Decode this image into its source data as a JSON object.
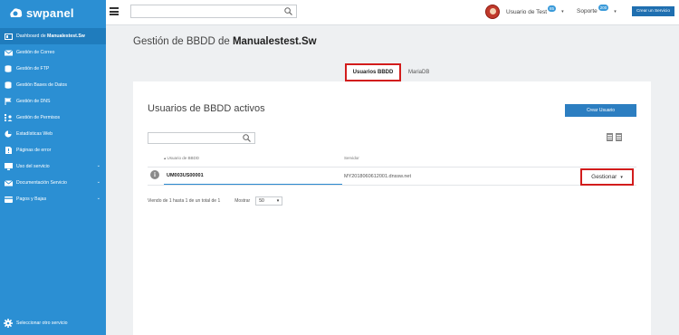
{
  "brand": {
    "name": "swpanel",
    "color": "#2b8fd3"
  },
  "sidebar": {
    "items": [
      {
        "label": "Dashboard de ",
        "bold": "Manualestest.Sw",
        "icon": "dashboard-icon"
      },
      {
        "label": "Gestión de Correo",
        "icon": "mail-icon"
      },
      {
        "label": "Gestión de FTP",
        "icon": "database-icon"
      },
      {
        "label": "Gestión Bases de Datos",
        "icon": "database-icon"
      },
      {
        "label": "Gestión de DNS",
        "icon": "flag-icon"
      },
      {
        "label": "Gestión de Permisos",
        "icon": "users-icon"
      },
      {
        "label": "Estadísticas Web",
        "icon": "pie-chart-icon"
      },
      {
        "label": "Páginas de error",
        "icon": "file-error-icon"
      },
      {
        "label": "Uso del servicio",
        "icon": "monitor-icon",
        "expandable": true
      },
      {
        "label": "Documentación Servicio",
        "icon": "envelope-icon",
        "expandable": true
      },
      {
        "label": "Pagos y Bajas",
        "icon": "card-icon",
        "expandable": true
      }
    ],
    "bottom": "Seleccionar otro servicio"
  },
  "topbar": {
    "user_name": "Usuario de Test",
    "user_badge": "85",
    "support_label": "Soporte",
    "support_badge": "200",
    "create_service": "Crear un Servicio",
    "caret": "▾"
  },
  "page": {
    "title_prefix": "Gestión de BBDD de ",
    "title_name": "Manualestest.Sw"
  },
  "tabs": [
    {
      "label": "Usuarios BBDD",
      "active": true
    },
    {
      "label": "MariaDB",
      "active": false
    }
  ],
  "card": {
    "title": "Usuarios de BBDD activos",
    "create_user": "Crear Usuario",
    "columns": [
      "Usuario de BBDD",
      "Servidor"
    ],
    "sort_indicator": "▴",
    "rows": [
      {
        "user": "UM003US00001",
        "server": "MY2018060612001.dnssw.net",
        "manage": "Gestionar"
      }
    ],
    "info_icon": "i",
    "footer": {
      "summary": "Viendo de 1 hasta 1 de un total de 1",
      "show_label": "Mostrar",
      "page_size": "50"
    }
  }
}
